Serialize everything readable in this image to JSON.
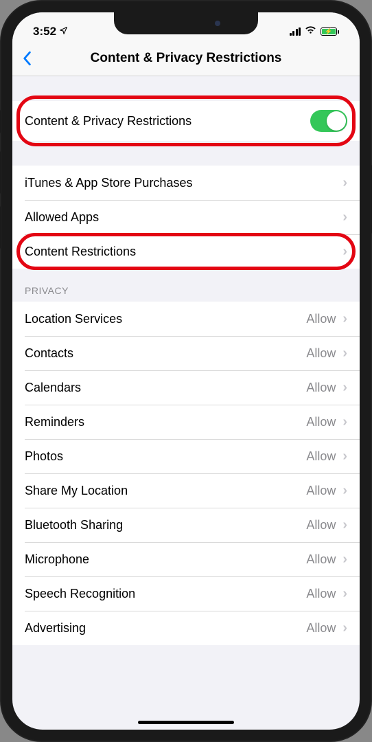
{
  "status": {
    "time": "3:52"
  },
  "nav": {
    "title": "Content & Privacy Restrictions"
  },
  "toggleRow": {
    "label": "Content & Privacy Restrictions",
    "enabled": true
  },
  "mainRows": [
    {
      "label": "iTunes & App Store Purchases"
    },
    {
      "label": "Allowed Apps"
    },
    {
      "label": "Content Restrictions"
    }
  ],
  "privacyHeader": "PRIVACY",
  "privacyRows": [
    {
      "label": "Location Services",
      "value": "Allow"
    },
    {
      "label": "Contacts",
      "value": "Allow"
    },
    {
      "label": "Calendars",
      "value": "Allow"
    },
    {
      "label": "Reminders",
      "value": "Allow"
    },
    {
      "label": "Photos",
      "value": "Allow"
    },
    {
      "label": "Share My Location",
      "value": "Allow"
    },
    {
      "label": "Bluetooth Sharing",
      "value": "Allow"
    },
    {
      "label": "Microphone",
      "value": "Allow"
    },
    {
      "label": "Speech Recognition",
      "value": "Allow"
    },
    {
      "label": "Advertising",
      "value": "Allow"
    }
  ]
}
